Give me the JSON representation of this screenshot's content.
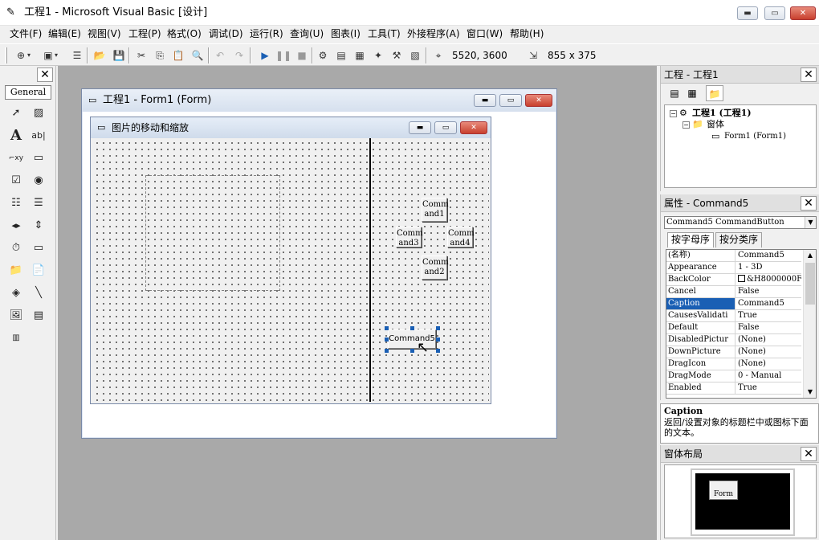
{
  "window": {
    "title": "工程1 - Microsoft Visual Basic [设计]",
    "minimize_glyph": "▬",
    "maximize_glyph": "▭",
    "close_glyph": "✕"
  },
  "menu": [
    "文件(F)",
    "编辑(E)",
    "视图(V)",
    "工程(P)",
    "格式(O)",
    "调试(D)",
    "运行(R)",
    "查询(U)",
    "图表(I)",
    "工具(T)",
    "外接程序(A)",
    "窗口(W)",
    "帮助(H)"
  ],
  "toolbar": {
    "position_readout": "5520, 3600",
    "size_readout": "855 x 375"
  },
  "toolbox": {
    "tab_label": "General",
    "close_glyph": "✕",
    "tools": [
      "pointer",
      "picturebox",
      "label",
      "textbox",
      "frame",
      "commandbutton",
      "checkbox",
      "optionbutton",
      "combobox",
      "listbox",
      "hscrollbar",
      "vscrollbar",
      "timer",
      "drivelistbox",
      "dirlistbox",
      "filelistbox",
      "shape",
      "line",
      "image",
      "data",
      "ole"
    ]
  },
  "project_form_window": {
    "title": "工程1 - Form1 (Form)"
  },
  "design_form": {
    "caption": "图片的移动和缩放",
    "buttons": {
      "command1": "Comm\nand1",
      "command2": "Comm\nand2",
      "command3": "Comm\nand3",
      "command4": "Comm\nand4",
      "command5": "Command5"
    }
  },
  "project_panel": {
    "title": "工程 - 工程1",
    "close_glyph": "✕",
    "tree": {
      "project": "工程1 (工程1)",
      "folder": "窗体",
      "form": "Form1 (Form1)"
    }
  },
  "properties_panel": {
    "title": "属性 - Command5",
    "close_glyph": "✕",
    "object_selector": "Command5 CommandButton",
    "tabs": [
      "按字母序",
      "按分类序"
    ],
    "rows": [
      {
        "name": "(名称)",
        "value": "Command5"
      },
      {
        "name": "Appearance",
        "value": "1 - 3D"
      },
      {
        "name": "BackColor",
        "value": "&H8000000F&"
      },
      {
        "name": "Cancel",
        "value": "False"
      },
      {
        "name": "Caption",
        "value": "Command5"
      },
      {
        "name": "CausesValidati",
        "value": "True"
      },
      {
        "name": "Default",
        "value": "False"
      },
      {
        "name": "DisabledPictur",
        "value": "(None)"
      },
      {
        "name": "DownPicture",
        "value": "(None)"
      },
      {
        "name": "DragIcon",
        "value": "(None)"
      },
      {
        "name": "DragMode",
        "value": "0 - Manual"
      },
      {
        "name": "Enabled",
        "value": "True"
      }
    ],
    "selected_row": "Caption"
  },
  "description": {
    "title": "Caption",
    "text": "返回/设置对象的标题栏中或图标下面的文本。"
  },
  "form_layout_panel": {
    "title": "窗体布局",
    "close_glyph": "✕",
    "mini_form_label": "Form"
  },
  "colors": {
    "selection_blue": "#1a5fb4",
    "design_background": "#a9a9a9",
    "close_red": "#c8402e"
  }
}
